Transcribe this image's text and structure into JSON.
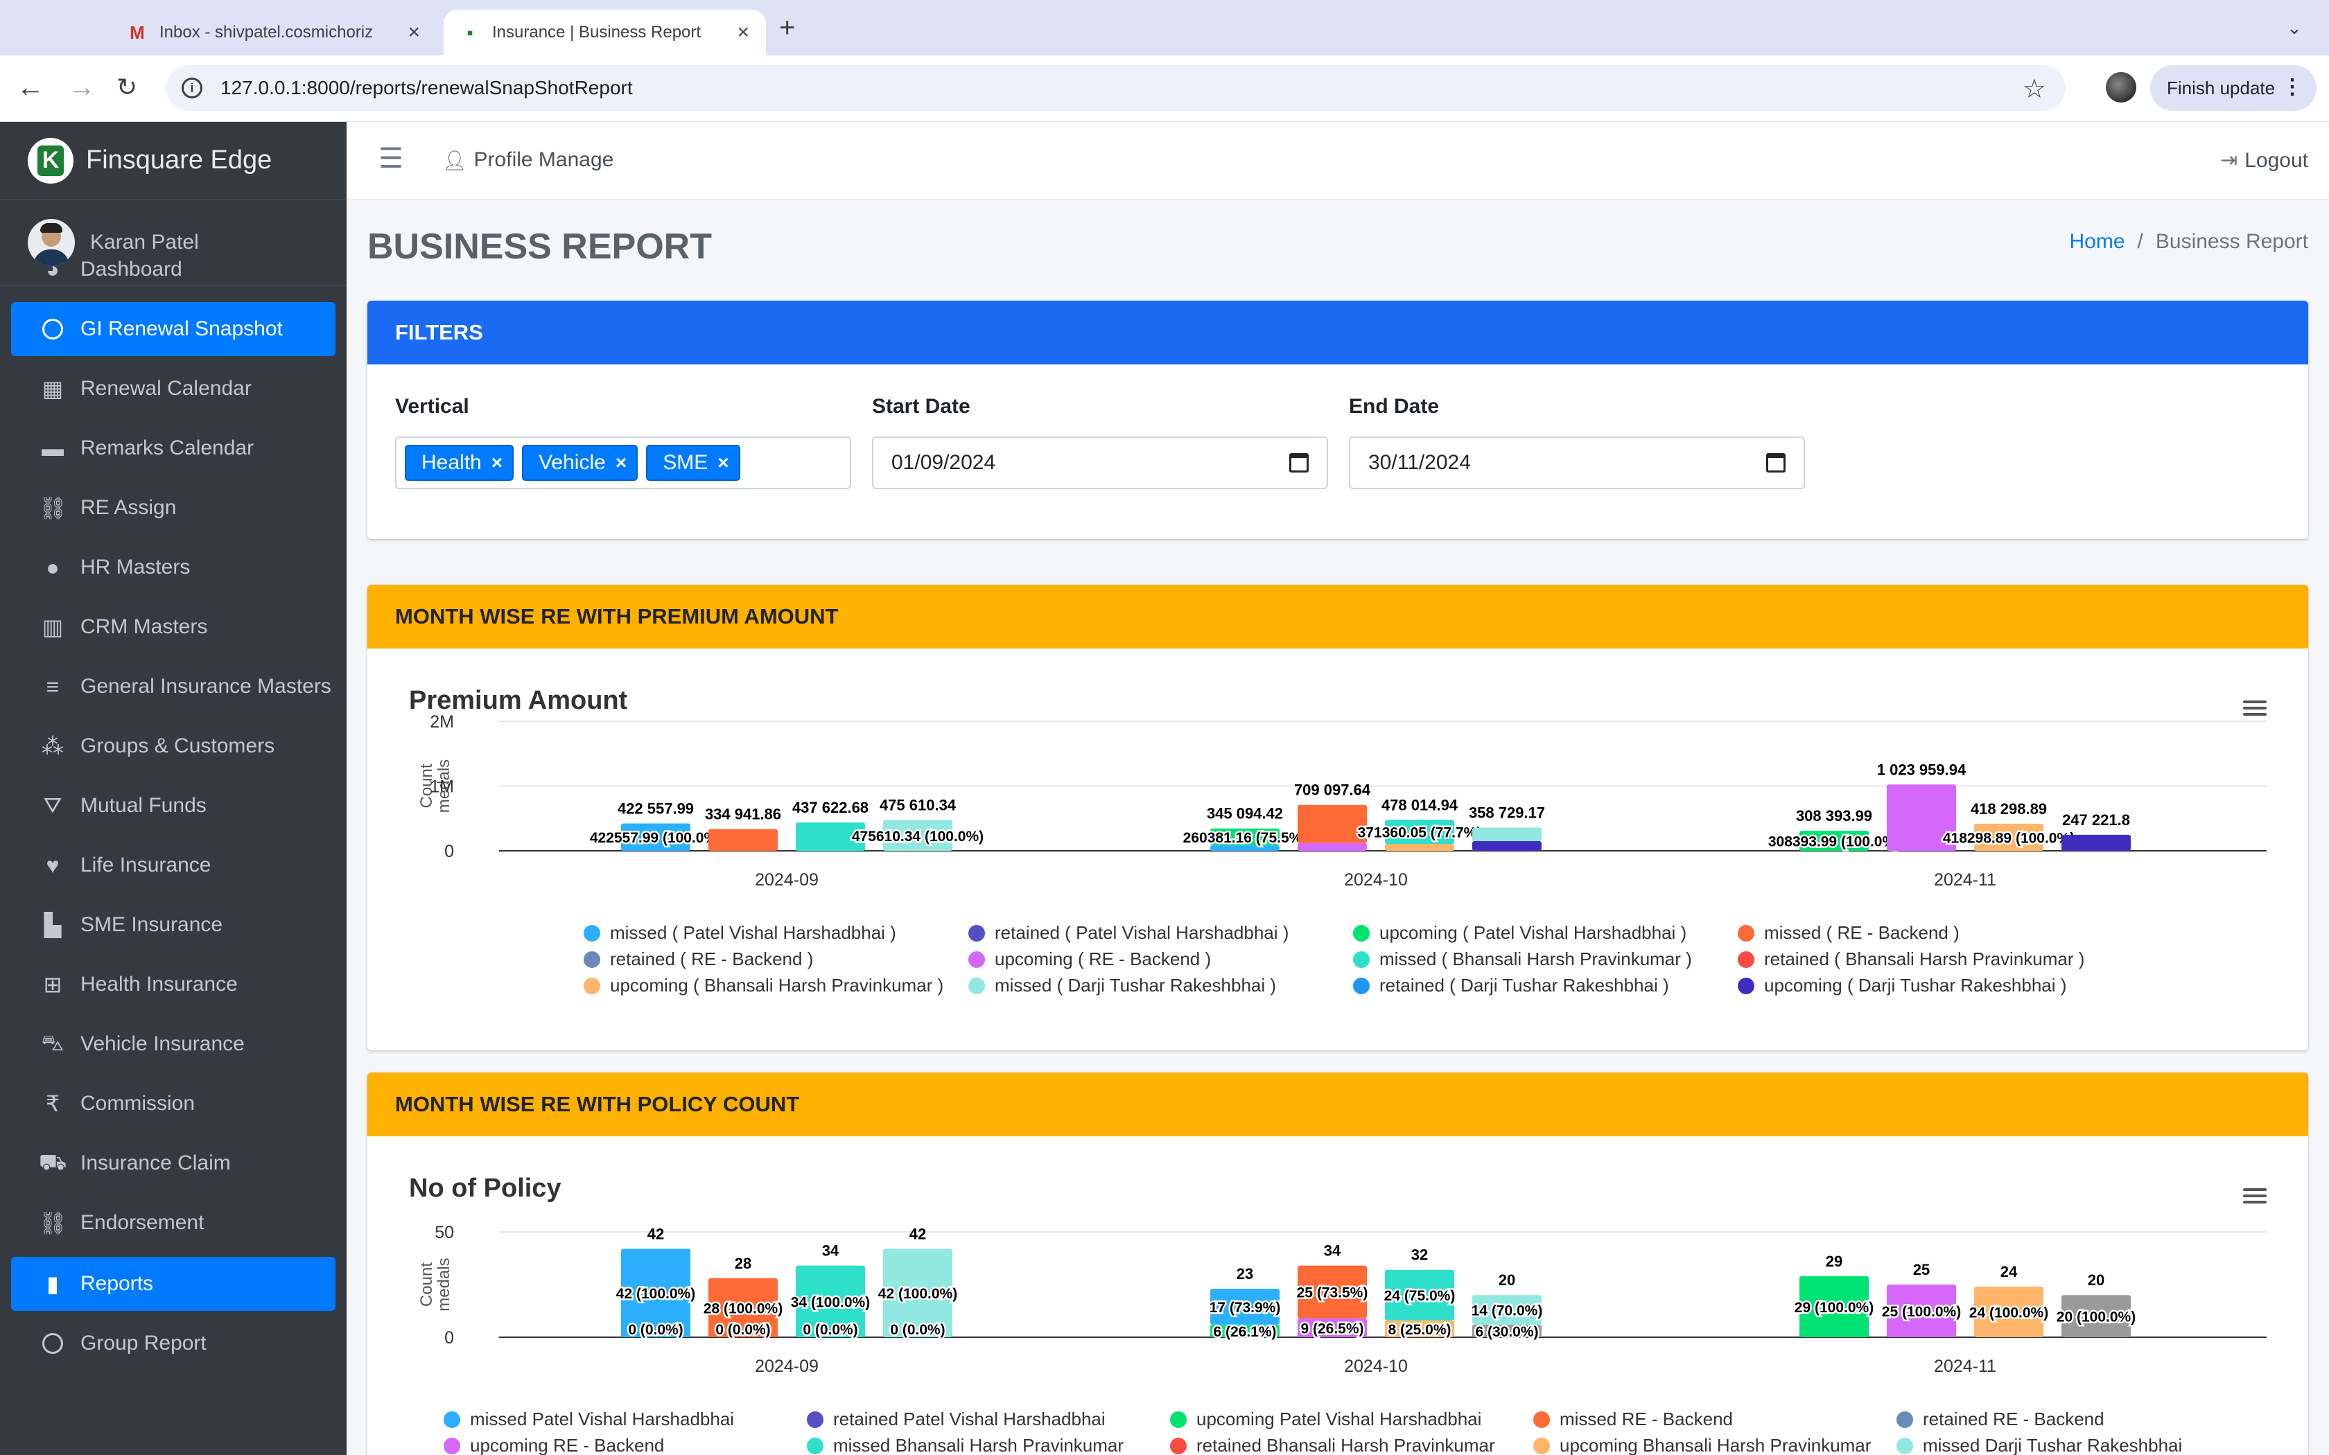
{
  "browser": {
    "tabs": [
      {
        "title": "Inbox - shivpatel.cosmichoriz",
        "favicon": "gmail-icon",
        "active": false
      },
      {
        "title": "Insurance | Business Report",
        "favicon": "site-icon",
        "active": true
      }
    ],
    "url": "127.0.0.1:8000/reports/renewalSnapShotReport",
    "finish_update": "Finish update"
  },
  "brand": {
    "name": "Finsquare Edge"
  },
  "user": {
    "name": "Karan Patel"
  },
  "sidebar": {
    "items": [
      {
        "label": "Dashboard",
        "icon": "dashboard-icon",
        "glyph": "◕",
        "active": false
      },
      {
        "label": "GI Renewal Snapshot",
        "icon": "circle-icon",
        "glyph": "",
        "active": true
      },
      {
        "label": "Renewal Calendar",
        "icon": "calendar-icon",
        "glyph": "▦",
        "active": false
      },
      {
        "label": "Remarks Calendar",
        "icon": "calendar-icon",
        "glyph": "▬",
        "active": false
      },
      {
        "label": "RE Assign",
        "icon": "link-icon",
        "glyph": "⛓",
        "active": false
      },
      {
        "label": "HR Masters",
        "icon": "user-icon",
        "glyph": "●",
        "active": false
      },
      {
        "label": "CRM Masters",
        "icon": "building-icon",
        "glyph": "▥",
        "active": false
      },
      {
        "label": "General Insurance Masters",
        "icon": "database-icon",
        "glyph": "≡",
        "active": false
      },
      {
        "label": "Groups & Customers",
        "icon": "users-icon",
        "glyph": "⁂",
        "active": false
      },
      {
        "label": "Mutual Funds",
        "icon": "funnel-dollar-icon",
        "glyph": "⛛",
        "active": false
      },
      {
        "label": "Life Insurance",
        "icon": "heart-icon",
        "glyph": "♥",
        "active": false
      },
      {
        "label": "SME Insurance",
        "icon": "industry-icon",
        "glyph": "▙",
        "active": false
      },
      {
        "label": "Health Insurance",
        "icon": "plus-square-icon",
        "glyph": "⊞",
        "active": false
      },
      {
        "label": "Vehicle Insurance",
        "icon": "car-icon",
        "glyph": "⛍",
        "active": false
      },
      {
        "label": "Commission",
        "icon": "rupee-icon",
        "glyph": "₹",
        "active": false
      },
      {
        "label": "Insurance Claim",
        "icon": "ambulance-icon",
        "glyph": "⛟",
        "active": false
      },
      {
        "label": "Endorsement",
        "icon": "link-icon",
        "glyph": "⛓",
        "active": false
      },
      {
        "label": "Reports",
        "icon": "file-icon",
        "glyph": "▮",
        "active": true
      },
      {
        "label": "Group Report",
        "icon": "circle-icon",
        "glyph": "",
        "active": false
      }
    ]
  },
  "topnav": {
    "profile": "Profile Manage",
    "logout": "Logout"
  },
  "page": {
    "title": "BUSINESS REPORT",
    "breadcrumb_home": "Home",
    "breadcrumb_current": "Business Report"
  },
  "filters": {
    "header": "FILTERS",
    "vertical_label": "Vertical",
    "vertical_chips": [
      "Health",
      "Vehicle",
      "SME"
    ],
    "start_label": "Start Date",
    "start_value": "01/09/2024",
    "end_label": "End Date",
    "end_value": "30/11/2024"
  },
  "premium_section": {
    "header": "MONTH WISE RE WITH PREMIUM AMOUNT",
    "chart_title": "Premium Amount"
  },
  "policy_section": {
    "header": "MONTH WISE RE WITH POLICY COUNT",
    "chart_title": "No of Policy"
  },
  "colors": {
    "series": [
      "#2caffe",
      "#544fc5",
      "#00e272",
      "#fe6a35",
      "#6b8abc",
      "#d568fb",
      "#2ee0ca",
      "#fa4b42",
      "#feb56a",
      "#91e8e1",
      "#2196f3",
      "#3f2dbf"
    ]
  },
  "chart_data": [
    {
      "type": "bar",
      "title": "Premium Amount",
      "ylabel": "Count medals",
      "ylim": [
        0,
        2000000
      ],
      "yticks": [
        "0",
        "1M",
        "2M"
      ],
      "categories": [
        "2024-09",
        "2024-10",
        "2024-11"
      ],
      "series": [
        {
          "name": "missed ( Patel Vishal Harshadbhai )",
          "color": "#2caffe"
        },
        {
          "name": "retained ( Patel Vishal Harshadbhai )",
          "color": "#544fc5"
        },
        {
          "name": "upcoming ( Patel Vishal Harshadbhai )",
          "color": "#00e272"
        },
        {
          "name": "missed ( RE - Backend )",
          "color": "#fe6a35"
        },
        {
          "name": "retained ( RE - Backend )",
          "color": "#6b8abc"
        },
        {
          "name": "upcoming ( RE - Backend )",
          "color": "#d568fb"
        },
        {
          "name": "missed ( Bhansali Harsh Pravinkumar )",
          "color": "#2ee0ca"
        },
        {
          "name": "retained ( Bhansali Harsh Pravinkumar )",
          "color": "#fa4b42"
        },
        {
          "name": "upcoming ( Bhansali Harsh Pravinkumar )",
          "color": "#feb56a"
        },
        {
          "name": "missed ( Darji Tushar Rakeshbhai )",
          "color": "#91e8e1"
        },
        {
          "name": "retained ( Darji Tushar Rakeshbhai )",
          "color": "#2196f3"
        },
        {
          "name": "upcoming ( Darji Tushar Rakeshbhai )",
          "color": "#3f2dbf"
        }
      ],
      "bars": [
        {
          "category": "2024-09",
          "total": 422557.99,
          "total_label": "422 557.99",
          "segments": [
            {
              "series": "missed ( Patel Vishal Harshadbhai )",
              "value": 422557.99,
              "label": "422557.99 (100.0%)"
            }
          ]
        },
        {
          "category": "2024-09",
          "total": 334941.86,
          "total_label": "334 941.86",
          "segments": [
            {
              "series": "missed ( RE - Backend )",
              "value": 334941.86,
              "label": ""
            }
          ]
        },
        {
          "category": "2024-09",
          "total": 437622.68,
          "total_label": "437 622.68",
          "segments": [
            {
              "series": "missed ( Bhansali Harsh Pravinkumar )",
              "value": 437622.68,
              "label": ""
            }
          ]
        },
        {
          "category": "2024-09",
          "total": 475610.34,
          "total_label": "475 610.34",
          "segments": [
            {
              "series": "missed ( Darji Tushar Rakeshbhai )",
              "value": 475610.34,
              "label": "475610.34 (100.0%)"
            }
          ]
        },
        {
          "category": "2024-10",
          "total": 345094.42,
          "total_label": "345 094.42",
          "segments": [
            {
              "series": "missed ( Patel Vishal Harshadbhai )",
              "value": 84713.26,
              "label": ""
            },
            {
              "series": "upcoming ( Patel Vishal Harshadbhai )",
              "value": 260381.16,
              "label": "260381.16 (75.5%)"
            }
          ]
        },
        {
          "category": "2024-10",
          "total": 709097.64,
          "total_label": "709 097.64",
          "segments": [
            {
              "series": "upcoming ( RE - Backend )",
              "value": 120000,
              "label": ""
            },
            {
              "series": "missed ( RE - Backend )",
              "value": 589097.64,
              "label": ""
            }
          ]
        },
        {
          "category": "2024-10",
          "total": 478014.94,
          "total_label": "478 014.94",
          "segments": [
            {
              "series": "upcoming ( Bhansali Harsh Pravinkumar )",
              "value": 106654.89,
              "label": ""
            },
            {
              "series": "missed ( Bhansali Harsh Pravinkumar )",
              "value": 371360.05,
              "label": "371360.05 (77.7%)"
            }
          ]
        },
        {
          "category": "2024-10",
          "total": 358729.17,
          "total_label": "358 729.17",
          "segments": [
            {
              "series": "upcoming ( Darji Tushar Rakeshbhai )",
              "value": 150000,
              "label": ""
            },
            {
              "series": "missed ( Darji Tushar Rakeshbhai )",
              "value": 208729.17,
              "label": ""
            }
          ]
        },
        {
          "category": "2024-11",
          "total": 308393.99,
          "total_label": "308 393.99",
          "segments": [
            {
              "series": "upcoming ( Patel Vishal Harshadbhai )",
              "value": 308393.99,
              "label": "308393.99 (100.0%)"
            }
          ]
        },
        {
          "category": "2024-11",
          "total": 1023959.94,
          "total_label": "1 023 959.94",
          "segments": [
            {
              "series": "upcoming ( RE - Backend )",
              "value": 1023959.94,
              "label": ""
            }
          ]
        },
        {
          "category": "2024-11",
          "total": 418298.89,
          "total_label": "418 298.89",
          "segments": [
            {
              "series": "upcoming ( Bhansali Harsh Pravinkumar )",
              "value": 418298.89,
              "label": "418298.89 (100.0%)"
            }
          ]
        },
        {
          "category": "2024-11",
          "total": 247221.8,
          "total_label": "247 221.8",
          "segments": [
            {
              "series": "upcoming ( Darji Tushar Rakeshbhai )",
              "value": 247221.8,
              "label": ""
            }
          ]
        }
      ]
    },
    {
      "type": "bar",
      "title": "No of Policy",
      "ylabel": "Count medals",
      "ylim": [
        0,
        50
      ],
      "yticks": [
        "0",
        "50"
      ],
      "categories": [
        "2024-09",
        "2024-10",
        "2024-11"
      ],
      "series": [
        {
          "name": "missed Patel Vishal Harshadbhai",
          "color": "#2caffe"
        },
        {
          "name": "retained Patel Vishal Harshadbhai",
          "color": "#544fc5"
        },
        {
          "name": "upcoming Patel Vishal Harshadbhai",
          "color": "#00e272"
        },
        {
          "name": "missed RE - Backend",
          "color": "#fe6a35"
        },
        {
          "name": "retained RE - Backend",
          "color": "#6b8abc"
        },
        {
          "name": "upcoming RE - Backend",
          "color": "#d568fb"
        },
        {
          "name": "missed Bhansali Harsh Pravinkumar",
          "color": "#2ee0ca"
        },
        {
          "name": "retained Bhansali Harsh Pravinkumar",
          "color": "#fa4b42"
        },
        {
          "name": "upcoming Bhansali Harsh Pravinkumar",
          "color": "#feb56a"
        },
        {
          "name": "missed Darji Tushar Rakeshbhai",
          "color": "#91e8e1"
        }
      ],
      "bars": [
        {
          "category": "2024-09",
          "total": 42,
          "total_label": "42",
          "segments": [
            {
              "series": "missed Patel Vishal Harshadbhai",
              "value": 42,
              "label": "42 (100.0%)"
            }
          ],
          "zero_label": "0 (0.0%)"
        },
        {
          "category": "2024-09",
          "total": 28,
          "total_label": "28",
          "segments": [
            {
              "series": "missed RE - Backend",
              "value": 28,
              "label": "28 (100.0%)"
            }
          ],
          "zero_label": "0 (0.0%)"
        },
        {
          "category": "2024-09",
          "total": 34,
          "total_label": "34",
          "segments": [
            {
              "series": "missed Bhansali Harsh Pravinkumar",
              "value": 34,
              "label": "34 (100.0%)"
            }
          ],
          "zero_label": "0 (0.0%)"
        },
        {
          "category": "2024-09",
          "total": 42,
          "total_label": "42",
          "segments": [
            {
              "series": "missed Darji Tushar Rakeshbhai",
              "value": 42,
              "label": "42 (100.0%)"
            }
          ],
          "zero_label": "0 (0.0%)"
        },
        {
          "category": "2024-10",
          "total": 23,
          "total_label": "23",
          "segments": [
            {
              "series": "upcoming Patel Vishal Harshadbhai",
              "value": 6,
              "label": "6 (26.1%)"
            },
            {
              "series": "missed Patel Vishal Harshadbhai",
              "value": 17,
              "label": "17 (73.9%)"
            }
          ]
        },
        {
          "category": "2024-10",
          "total": 34,
          "total_label": "34",
          "segments": [
            {
              "series": "upcoming RE - Backend",
              "value": 9,
              "label": "9 (26.5%)"
            },
            {
              "series": "missed RE - Backend",
              "value": 25,
              "label": "25 (73.5%)"
            }
          ]
        },
        {
          "category": "2024-10",
          "total": 32,
          "total_label": "32",
          "segments": [
            {
              "series": "upcoming Bhansali Harsh Pravinkumar",
              "value": 8,
              "label": "8 (25.0%)"
            },
            {
              "series": "missed Bhansali Harsh Pravinkumar",
              "value": 24,
              "label": "24 (75.0%)"
            }
          ]
        },
        {
          "category": "2024-10",
          "total": 20,
          "total_label": "20",
          "segments": [
            {
              "series": "upcoming Darji Tushar Rakeshbhai",
              "value": 6,
              "label": "6 (30.0%)"
            },
            {
              "series": "missed Darji Tushar Rakeshbhai",
              "value": 14,
              "label": "14 (70.0%)"
            }
          ]
        },
        {
          "category": "2024-11",
          "total": 29,
          "total_label": "29",
          "segments": [
            {
              "series": "upcoming Patel Vishal Harshadbhai",
              "value": 29,
              "label": "29 (100.0%)"
            }
          ]
        },
        {
          "category": "2024-11",
          "total": 25,
          "total_label": "25",
          "segments": [
            {
              "series": "upcoming RE - Backend",
              "value": 25,
              "label": "25 (100.0%)"
            }
          ]
        },
        {
          "category": "2024-11",
          "total": 24,
          "total_label": "24",
          "segments": [
            {
              "series": "upcoming Bhansali Harsh Pravinkumar",
              "value": 24,
              "label": "24 (100.0%)"
            }
          ]
        },
        {
          "category": "2024-11",
          "total": 20,
          "total_label": "20",
          "segments": [
            {
              "series": "upcoming Darji Tushar Rakeshbhai",
              "value": 20,
              "label": "20 (100.0%)"
            }
          ]
        }
      ]
    }
  ]
}
